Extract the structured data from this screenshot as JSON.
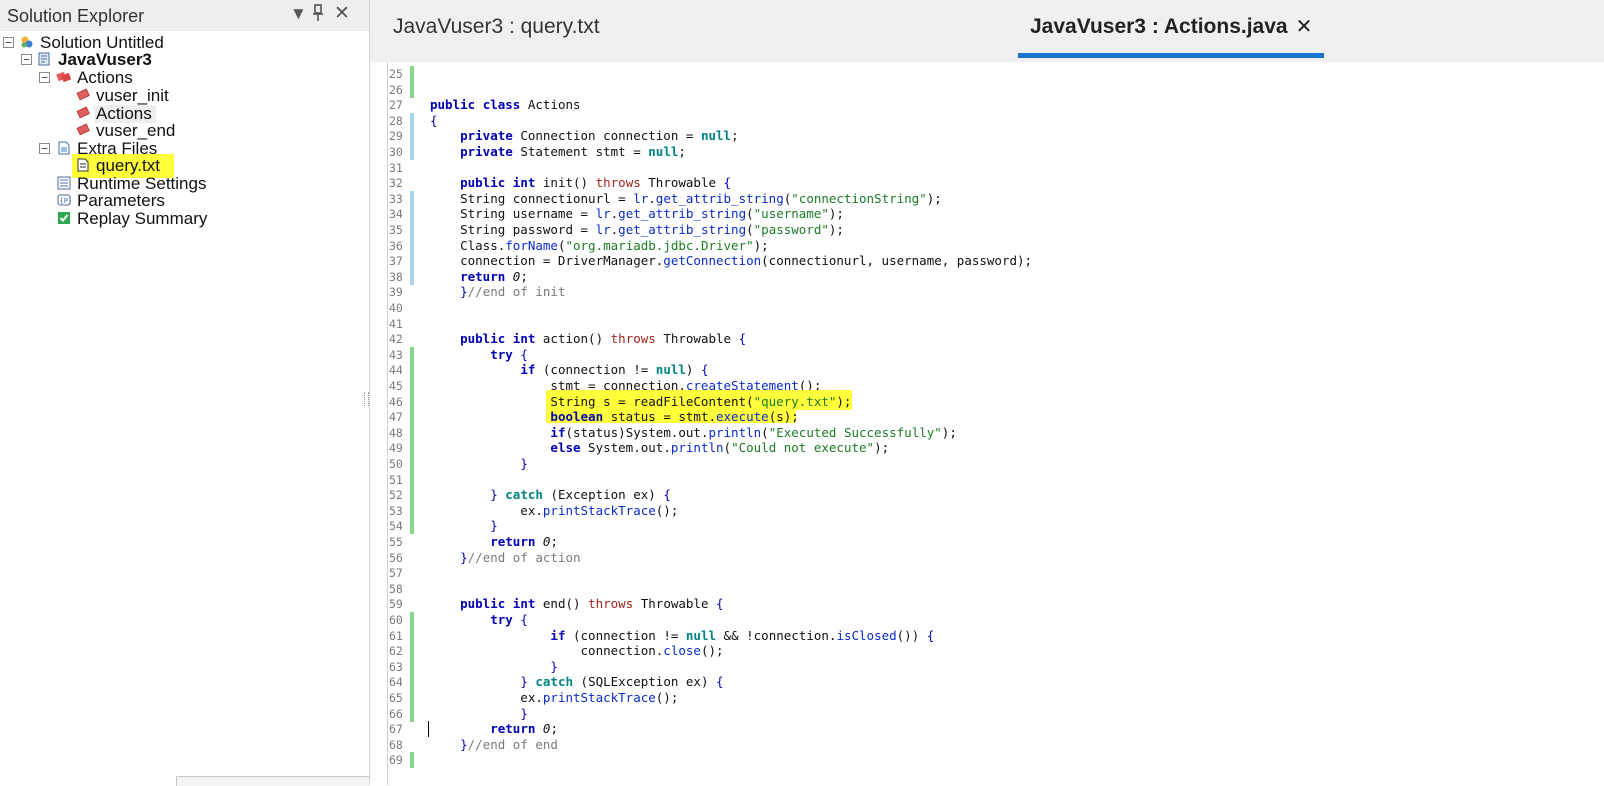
{
  "explorer": {
    "title": "Solution Explorer",
    "dropdown_glyph": "▼",
    "pin_glyph": "📌",
    "close_glyph": "✕",
    "tree": [
      {
        "label": "Solution Untitled",
        "icon": "solution-icon",
        "expander": "−"
      },
      {
        "label": "JavaVuser3",
        "icon": "script-icon",
        "expander": "−"
      },
      {
        "label": "Actions",
        "icon": "actions-folder-icon",
        "expander": "−"
      },
      {
        "label": "vuser_init",
        "icon": "action-icon"
      },
      {
        "label": "Actions",
        "icon": "action-icon"
      },
      {
        "label": "vuser_end",
        "icon": "action-icon"
      },
      {
        "label": "Extra Files",
        "icon": "extra-files-icon",
        "expander": "−"
      },
      {
        "label": "query.txt",
        "icon": "text-file-icon"
      },
      {
        "label": "Runtime Settings",
        "icon": "runtime-settings-icon"
      },
      {
        "label": "Parameters",
        "icon": "parameters-icon"
      },
      {
        "label": "Replay Summary",
        "icon": "replay-summary-icon"
      }
    ]
  },
  "tabs": [
    {
      "label": "JavaVuser3 : query.txt",
      "active": false
    },
    {
      "label": "JavaVuser3 : Actions.java",
      "active": true,
      "close_glyph": "✕"
    }
  ],
  "editor": {
    "line_numbers": [
      "25",
      "26",
      "27",
      "28",
      "29",
      "30",
      "31",
      "32",
      "33",
      "34",
      "35",
      "36",
      "37",
      "38",
      "39",
      "40",
      "41",
      "42",
      "43",
      "44",
      "45",
      "46",
      "47",
      "48",
      "49",
      "50",
      "51",
      "52",
      "53",
      "54",
      "55",
      "56",
      "57",
      "58",
      "59",
      "60",
      "61",
      "62",
      "63",
      "64",
      "65",
      "66",
      "67",
      "68",
      "69"
    ],
    "lines": [
      "",
      "",
      "public class Actions",
      "{",
      "    private Connection connection = null;",
      "    private Statement stmt = null;",
      "",
      "    public int init() throws Throwable {",
      "    String connectionurl = lr.get_attrib_string(\"connectionString\");",
      "    String username = lr.get_attrib_string(\"username\");",
      "    String password = lr.get_attrib_string(\"password\");",
      "    Class.forName(\"org.mariadb.jdbc.Driver\");",
      "    connection = DriverManager.getConnection(connectionurl, username, password);",
      "    return 0;",
      "    }//end of init",
      "",
      "",
      "    public int action() throws Throwable {",
      "        try {",
      "            if (connection != null) {",
      "                stmt = connection.createStatement();",
      "                String s = readFileContent(\"query.txt\");",
      "                boolean status = stmt.execute(s);",
      "                if(status)System.out.println(\"Executed Successfully\");",
      "                else System.out.println(\"Could not execute\");",
      "            }",
      "",
      "        } catch (Exception ex) {",
      "            ex.printStackTrace();",
      "        }",
      "        return 0;",
      "    }//end of action",
      "",
      "",
      "    public int end() throws Throwable {",
      "        try {",
      "                if (connection != null && !connection.isClosed()) {",
      "                    connection.close();",
      "                }",
      "            } catch (SQLException ex) {",
      "            ex.printStackTrace();",
      "            }",
      "        return 0;",
      "    }//end of end",
      ""
    ],
    "change_marks": [
      "g",
      "g",
      "",
      "b",
      "b",
      "b",
      "",
      "",
      "b",
      "b",
      "b",
      "b",
      "b",
      "b",
      "",
      "",
      "",
      "",
      "g",
      "g",
      "g",
      "g",
      "g",
      "g",
      "g",
      "g",
      "g",
      "g",
      "g",
      "g",
      "",
      "",
      "",
      "",
      "",
      "g",
      "g",
      "g",
      "g",
      "g",
      "g",
      "g",
      "",
      "",
      "g"
    ],
    "colors": {
      "keyword": "#0000b4",
      "string": "#1c7c24",
      "method": "#0a2cc8",
      "comment": "#7a7a7a",
      "highlight": "#ffff3c",
      "tab_underline": "#1874d0"
    }
  }
}
